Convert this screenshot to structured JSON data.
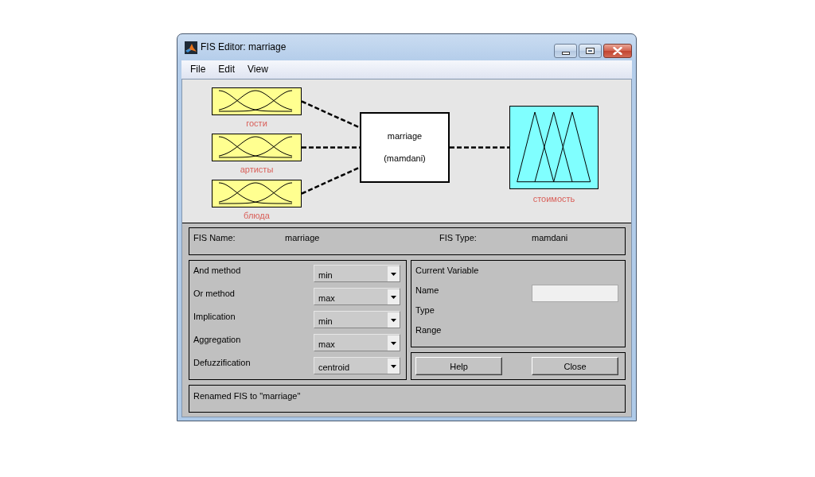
{
  "window": {
    "title": "FIS Editor: marriage"
  },
  "menu": [
    "File",
    "Edit",
    "View"
  ],
  "diagram": {
    "inputs": [
      {
        "name": "гости"
      },
      {
        "name": "артисты"
      },
      {
        "name": "блюда"
      }
    ],
    "system": {
      "name": "marriage",
      "type": "(mamdani)"
    },
    "outputs": [
      {
        "name": "стоимость"
      }
    ]
  },
  "fis_info": {
    "name_label": "FIS Name:",
    "name": "marriage",
    "type_label": "FIS Type:",
    "type": "mamdani"
  },
  "methods": [
    {
      "label": "And method",
      "value": "min"
    },
    {
      "label": "Or method",
      "value": "max"
    },
    {
      "label": "Implication",
      "value": "min"
    },
    {
      "label": "Aggregation",
      "value": "max"
    },
    {
      "label": "Defuzzification",
      "value": "centroid"
    }
  ],
  "current_variable": {
    "title": "Current Variable",
    "rows": [
      {
        "label": "Name",
        "kind": "input"
      },
      {
        "label": "Type",
        "kind": "label"
      },
      {
        "label": "Range",
        "kind": "label"
      }
    ]
  },
  "buttons": [
    "Help",
    "Close"
  ],
  "status": "Renamed FIS to \"marriage\""
}
